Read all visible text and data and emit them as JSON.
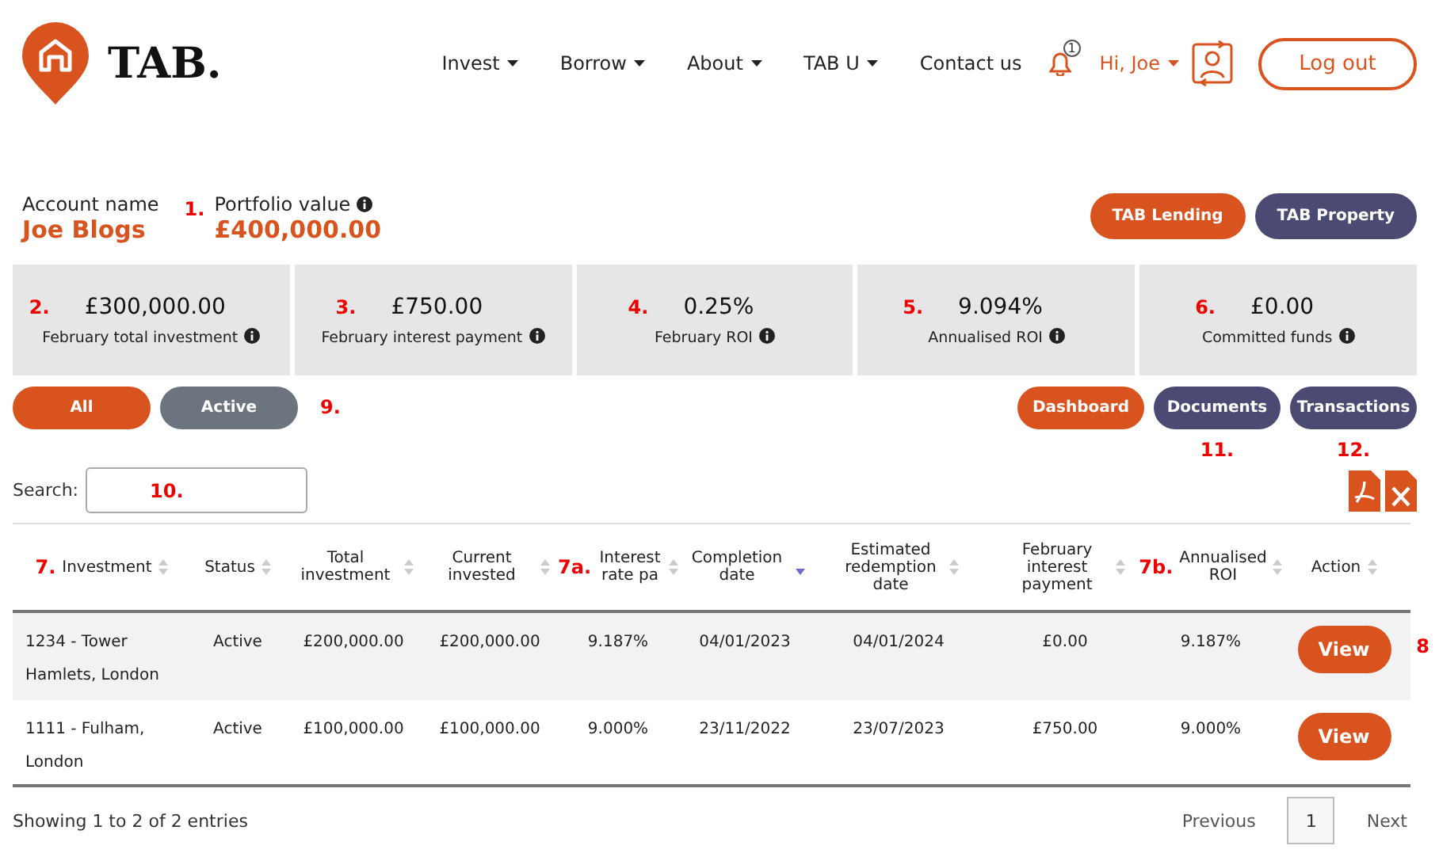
{
  "header": {
    "brand": "TAB.",
    "nav": [
      {
        "label": "Invest",
        "dropdown": true
      },
      {
        "label": "Borrow",
        "dropdown": true
      },
      {
        "label": "About",
        "dropdown": true
      },
      {
        "label": "TAB U",
        "dropdown": true
      },
      {
        "label": "Contact us",
        "dropdown": false
      }
    ],
    "notification_count": "1",
    "greeting": "Hi, Joe",
    "logout": "Log out"
  },
  "account": {
    "name_label": "Account name",
    "name": "Joe Blogs",
    "value_marker": "1.",
    "value_label": "Portfolio value",
    "value": "£400,000.00"
  },
  "product_buttons": [
    {
      "label": "TAB Lending",
      "kind": "primary"
    },
    {
      "label": "TAB Property",
      "kind": "dark"
    }
  ],
  "stats": [
    {
      "marker": "2.",
      "value": "£300,000.00",
      "label": "February total investment"
    },
    {
      "marker": "3.",
      "value": "£750.00",
      "label": "February interest payment"
    },
    {
      "marker": "4.",
      "value": "0.25%",
      "label": "February ROI"
    },
    {
      "marker": "5.",
      "value": "9.094%",
      "label": "Annualised ROI"
    },
    {
      "marker": "6.",
      "value": "£0.00",
      "label": "Committed funds"
    }
  ],
  "filters": [
    {
      "label": "All",
      "selected": true
    },
    {
      "label": "Active",
      "selected": false
    }
  ],
  "filters_marker": "9.",
  "actions": [
    {
      "label": "Dashboard",
      "kind": "primary"
    },
    {
      "label": "Documents",
      "kind": "dark",
      "marker": "11."
    },
    {
      "label": "Transactions",
      "kind": "dark",
      "marker": "12."
    }
  ],
  "search": {
    "label": "Search:",
    "marker": "10."
  },
  "table": {
    "columns": [
      {
        "label": "Investment",
        "marker": "7.",
        "sorted": false
      },
      {
        "label": "Status",
        "sorted": false
      },
      {
        "label": "Total investment",
        "sorted": false
      },
      {
        "label": "Current invested",
        "sorted": false
      },
      {
        "label": "Interest rate pa",
        "marker": "7a.",
        "sorted": false
      },
      {
        "label": "Completion date",
        "sorted": true
      },
      {
        "label": "Estimated redemption date",
        "sorted": false
      },
      {
        "label": "February interest payment",
        "sorted": false
      },
      {
        "label": "Annualised ROI",
        "marker": "7b.",
        "sorted": false
      },
      {
        "label": "Action",
        "sorted": false
      }
    ],
    "rows": [
      {
        "cells": [
          "1234 - Tower Hamlets, London",
          "Active",
          "£200,000.00",
          "£200,000.00",
          "9.187%",
          "04/01/2023",
          "04/01/2024",
          "£0.00",
          "9.187%"
        ],
        "action": "View",
        "marker": "8"
      },
      {
        "cells": [
          "1111 - Fulham, London",
          "Active",
          "£100,000.00",
          "£100,000.00",
          "9.000%",
          "23/11/2022",
          "23/07/2023",
          "£750.00",
          "9.000%"
        ],
        "action": "View"
      }
    ]
  },
  "footer": {
    "info": "Showing 1 to 2 of 2 entries",
    "previous": "Previous",
    "pages": [
      {
        "label": "1",
        "selected": true
      }
    ],
    "next": "Next"
  }
}
